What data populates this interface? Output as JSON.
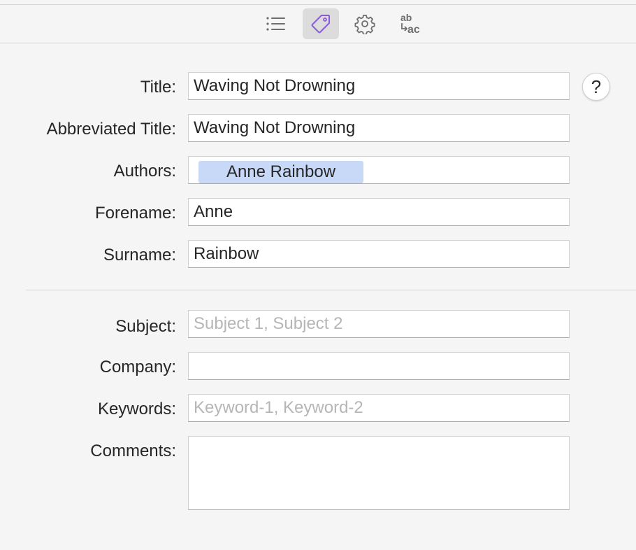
{
  "toolbar": {
    "tabs": [
      {
        "icon": "list-icon",
        "active": false
      },
      {
        "icon": "tag-icon",
        "active": true
      },
      {
        "icon": "gear-icon",
        "active": false
      },
      {
        "icon": "text-replace-icon",
        "active": false
      }
    ],
    "replace_icon_top": "ab",
    "replace_icon_bottom": "ac",
    "active_color": "#8a5cd6"
  },
  "form": {
    "title_label": "Title:",
    "title_value": "Waving Not Drowning",
    "abbrev_label": "Abbreviated Title:",
    "abbrev_value": "Waving Not Drowning",
    "authors_label": "Authors:",
    "authors_tokens": [
      "Anne Rainbow"
    ],
    "forename_label": "Forename:",
    "forename_value": "Anne",
    "surname_label": "Surname:",
    "surname_value": "Rainbow",
    "subject_label": "Subject:",
    "subject_value": "",
    "subject_placeholder": "Subject 1, Subject 2",
    "company_label": "Company:",
    "company_value": "",
    "keywords_label": "Keywords:",
    "keywords_value": "",
    "keywords_placeholder": "Keyword-1, Keyword-2",
    "comments_label": "Comments:",
    "comments_value": "",
    "help_label": "?"
  }
}
